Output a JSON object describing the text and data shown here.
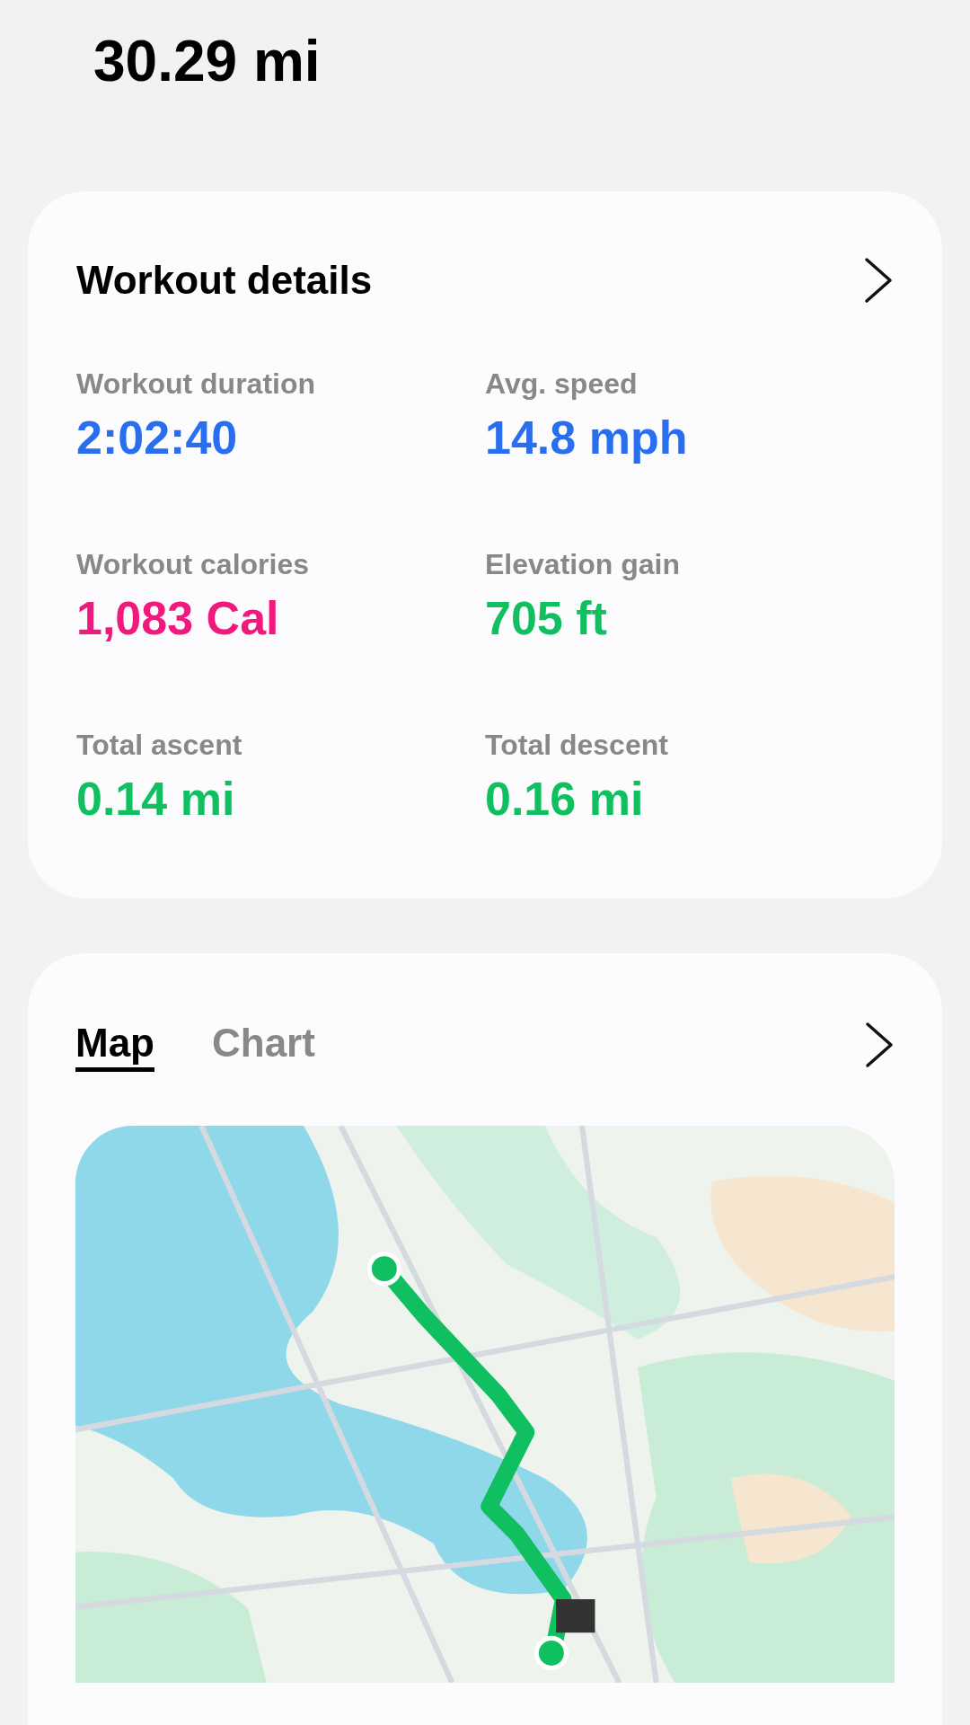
{
  "distance": "30.29 mi",
  "details": {
    "title": "Workout details",
    "metrics": [
      {
        "label": "Workout duration",
        "value": "2:02:40",
        "color": "#2a6ef0"
      },
      {
        "label": "Avg. speed",
        "value": "14.8 mph",
        "color": "#2a6ef0"
      },
      {
        "label": "Workout calories",
        "value": "1,083 Cal",
        "color": "#f0197d"
      },
      {
        "label": "Elevation gain",
        "value": "705 ft",
        "color": "#10c060"
      },
      {
        "label": "Total ascent",
        "value": "0.14 mi",
        "color": "#10c060"
      },
      {
        "label": "Total descent",
        "value": "0.16 mi",
        "color": "#10c060"
      }
    ]
  },
  "route": {
    "tabs": [
      {
        "label": "Map",
        "selected": true
      },
      {
        "label": "Chart",
        "selected": false
      }
    ]
  }
}
